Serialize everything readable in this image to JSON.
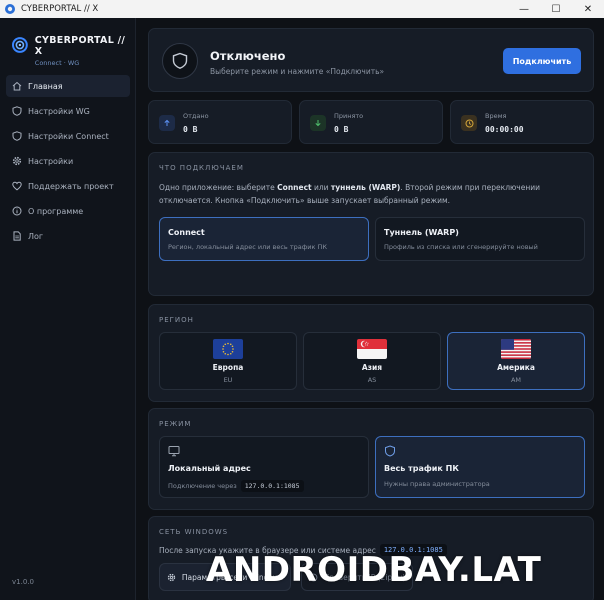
{
  "window": {
    "title": "CYBERPORTAL // X",
    "minimize": "—",
    "maximize": "☐",
    "close": "✕"
  },
  "brand": {
    "name": "CYBERPORTAL // X",
    "subtitle": "Connect · WG",
    "version": "v1.0.0"
  },
  "nav": [
    {
      "label": "Главная",
      "icon": "home-icon"
    },
    {
      "label": "Настройки WG",
      "icon": "shield-icon"
    },
    {
      "label": "Настройки Connect",
      "icon": "shield-icon"
    },
    {
      "label": "Настройки",
      "icon": "gear-icon"
    },
    {
      "label": "Поддержать проект",
      "icon": "heart-icon"
    },
    {
      "label": "О программе",
      "icon": "info-icon"
    },
    {
      "label": "Лог",
      "icon": "document-icon"
    }
  ],
  "status": {
    "title": "Отключено",
    "hint": "Выберите режим и нажмите «Подключить»",
    "connect_label": "Подключить"
  },
  "stats": [
    {
      "label": "Отдано",
      "value": "0 B",
      "icon": "arrow-up-icon",
      "color": "#3b6fd6"
    },
    {
      "label": "Принято",
      "value": "0 B",
      "icon": "arrow-down-icon",
      "color": "#3fa35a"
    },
    {
      "label": "Время",
      "value": "00:00:00",
      "icon": "clock-icon",
      "color": "#c79a2e"
    }
  ],
  "what": {
    "title": "ЧТО ПОДКЛЮЧАЕМ",
    "desc1": "Одно приложение: выберите ",
    "desc_connect": "Connect",
    "desc_or": " или ",
    "desc_tunnel": "туннель (WARP)",
    "desc2": ". Второй режим при переключении отключается. Кнопка «Подключить» выше запускает выбранный режим.",
    "options": [
      {
        "title": "Connect",
        "sub": "Регион, локальный адрес или весь трафик ПК"
      },
      {
        "title": "Туннель (WARP)",
        "sub": "Профиль из списка или сгенерируйте новый"
      }
    ]
  },
  "region": {
    "title": "РЕГИОН",
    "items": [
      {
        "name": "Европа",
        "code": "EU"
      },
      {
        "name": "Азия",
        "code": "AS"
      },
      {
        "name": "Америка",
        "code": "AM"
      }
    ]
  },
  "mode": {
    "title": "РЕЖИМ",
    "local_title": "Локальный адрес",
    "local_sub": "Подключение через",
    "local_addr": "127.0.0.1:1085",
    "all_title": "Весь трафик ПК",
    "all_sub": "Нужны права администратора"
  },
  "windows": {
    "title": "СЕТЬ WINDOWS",
    "desc": "После запуска укажите в браузере или системе адрес",
    "addr": "127.0.0.1:1085",
    "net_button": "Параметры сети Windows",
    "check_button": "Проверить IP (2ip.ru)"
  },
  "watermark": "ANDROIDBAY.LAT",
  "colors": {
    "accent": "#2f6fe0",
    "background": "#0e1116",
    "card": "#161c26",
    "selected_border": "#3d6fbf"
  }
}
